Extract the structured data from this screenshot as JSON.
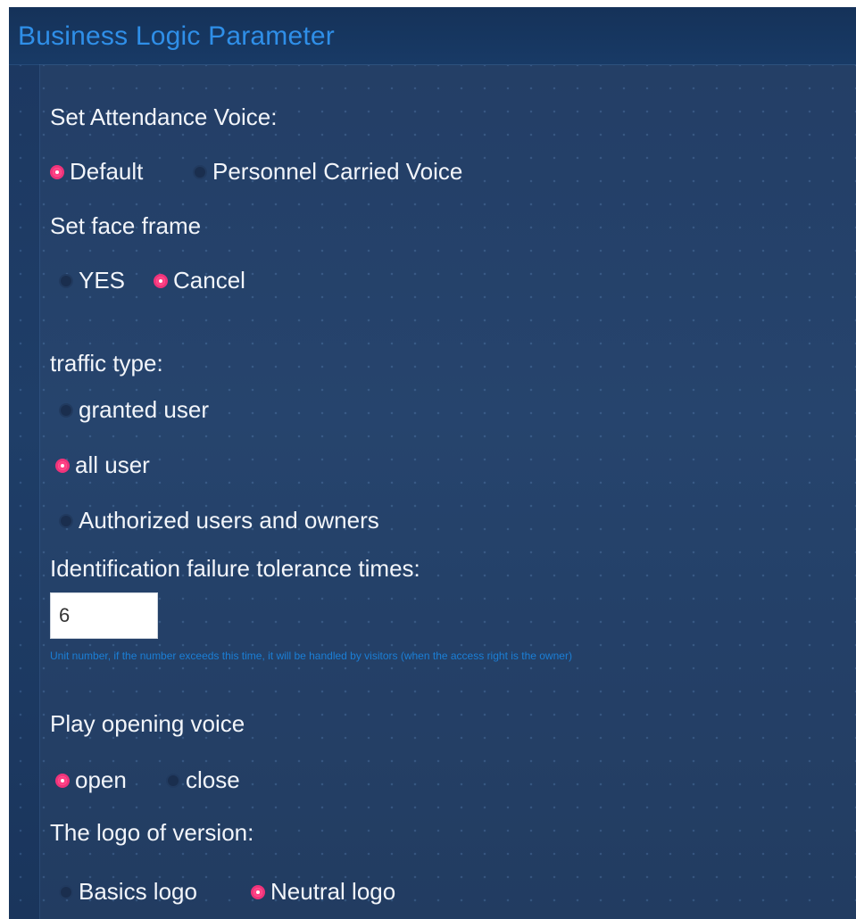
{
  "header": {
    "title": "Business Logic Parameter"
  },
  "attendance_voice": {
    "label": "Set Attendance Voice:",
    "options": [
      {
        "label": "Default",
        "selected": true
      },
      {
        "label": "Personnel Carried Voice",
        "selected": false
      }
    ]
  },
  "face_frame": {
    "label": "Set face frame",
    "options": [
      {
        "label": "YES",
        "selected": false
      },
      {
        "label": "Cancel",
        "selected": true
      }
    ]
  },
  "traffic_type": {
    "label": "traffic type:",
    "options": [
      {
        "label": "granted user",
        "selected": false
      },
      {
        "label": "all user",
        "selected": true
      },
      {
        "label": "Authorized users and owners",
        "selected": false
      }
    ]
  },
  "failure_tolerance": {
    "label": "Identification failure tolerance times:",
    "value": "6",
    "hint": "Unit number, if the number exceeds this time, it will be handled by visitors (when the access right is the owner)"
  },
  "opening_voice": {
    "label": "Play opening voice",
    "options": [
      {
        "label": "open",
        "selected": true
      },
      {
        "label": "close",
        "selected": false
      }
    ]
  },
  "version_logo": {
    "label": "The logo of version:",
    "options": [
      {
        "label": "Basics logo",
        "selected": false
      },
      {
        "label": "Neutral logo",
        "selected": true
      }
    ]
  },
  "colors": {
    "background": "#1d3a62",
    "title": "#2f8fe8",
    "radio_selected": "#f0337a",
    "hint": "#1b7fd6"
  }
}
